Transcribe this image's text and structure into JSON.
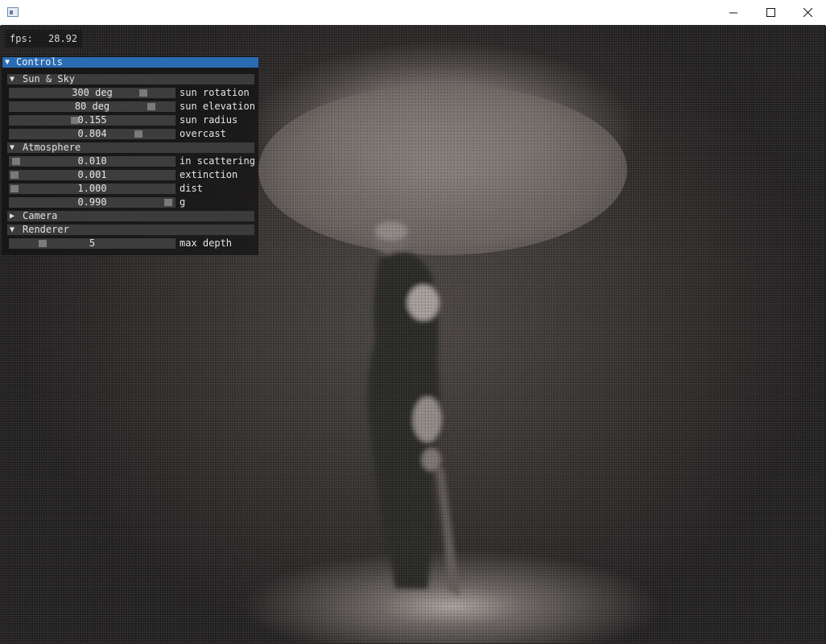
{
  "window": {
    "title": "",
    "buttons": {
      "minimize": "—",
      "maximize": "☐",
      "close": "✕"
    },
    "icon": "app-window-icon"
  },
  "fps": {
    "label": "fps:",
    "value": "28.92"
  },
  "controls": {
    "title": "Controls",
    "expanded": true,
    "sections": {
      "sun_sky": {
        "title": "Sun & Sky",
        "expanded": true,
        "sliders": [
          {
            "value": "300 deg",
            "label": "sun rotation",
            "fraction": 0.83
          },
          {
            "value": "80 deg",
            "label": "sun elevation",
            "fraction": 0.88
          },
          {
            "value": "0.155",
            "label": "sun radius",
            "fraction": 0.39
          },
          {
            "value": "0.804",
            "label": "overcast",
            "fraction": 0.8
          }
        ]
      },
      "atmosphere": {
        "title": "Atmosphere",
        "expanded": true,
        "sliders": [
          {
            "value": "0.010",
            "label": "in scattering",
            "fraction": 0.01
          },
          {
            "value": "0.001",
            "label": "extinction",
            "fraction": 0.0
          },
          {
            "value": "1.000",
            "label": "dist",
            "fraction": 0.0
          },
          {
            "value": "0.990",
            "label": "g",
            "fraction": 0.99
          }
        ]
      },
      "camera": {
        "title": "Camera",
        "expanded": false
      },
      "renderer": {
        "title": "Renderer",
        "expanded": true,
        "sliders": [
          {
            "value": "5",
            "label": "max depth",
            "fraction": 0.18
          }
        ]
      }
    }
  },
  "colors": {
    "header_accent": "#2a6bb5",
    "slider_bg": "#3d3d3d",
    "grab": "#7a7a7a"
  }
}
